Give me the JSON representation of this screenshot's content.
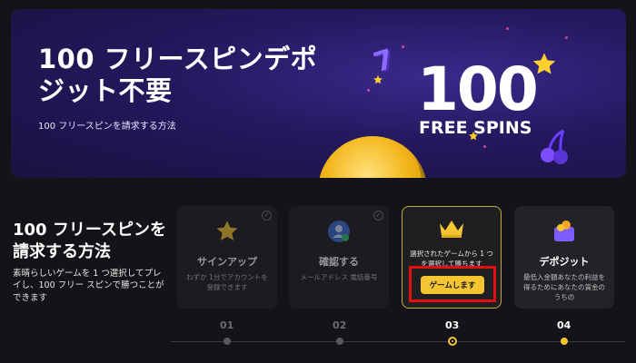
{
  "banner": {
    "title": "100 フリースピンデポジット不要",
    "subtitle": "100 フリースピンを請求する方法",
    "big_number": "100",
    "free_spins_label": "FREE SPINS",
    "seven_glyph": "7"
  },
  "section": {
    "title": "100 フリースピンを請求する方法",
    "description": "素晴らしいゲームを 1 つ選択してプレイし、100 フリー スピンで勝つことができます"
  },
  "steps": [
    {
      "title": "サインアップ",
      "desc": "わずか 1分でアカウントを登録できます",
      "number": "01",
      "icon": "star-icon"
    },
    {
      "title": "確認する",
      "desc": "メールアドレス 電話番号",
      "number": "02",
      "icon": "verify-profile-icon"
    },
    {
      "desc": "選択されたゲームから 1 つを選択して勝ちます",
      "button": "ゲームします",
      "number": "03",
      "icon": "crown-icon"
    },
    {
      "title": "デポジット",
      "desc": "最低入金額あなたの利益を得るためにあなたの賞金のうちの",
      "number": "04",
      "icon": "wallet-icon"
    }
  ],
  "colors": {
    "accent": "#f5c531",
    "highlight": "#e01010",
    "banner": "#24185e"
  }
}
